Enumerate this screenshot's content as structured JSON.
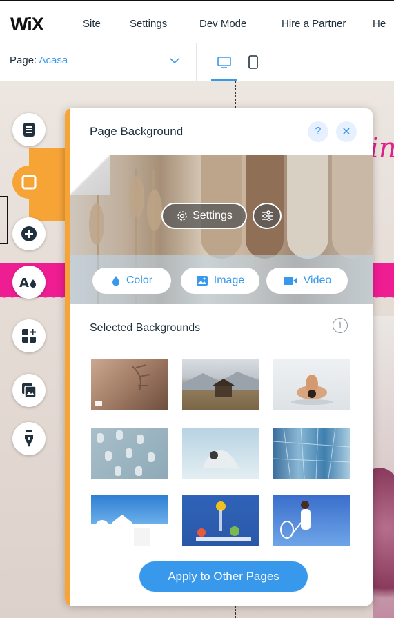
{
  "topbar": {
    "logo": "WiX",
    "menu": [
      "Site",
      "Settings",
      "Dev Mode",
      "Hire a Partner",
      "He"
    ]
  },
  "pagebar": {
    "page_label": "Page: ",
    "page_name": "Acasa",
    "devices": [
      "desktop-icon",
      "mobile-icon"
    ]
  },
  "canvas": {
    "script_text": "in"
  },
  "sidebar": {
    "tools": [
      "pages-icon",
      "background-icon",
      "add-icon",
      "theme-icon",
      "apps-icon",
      "media-icon",
      "blog-icon"
    ],
    "active_tool": "background-icon"
  },
  "panel": {
    "title": "Page Background",
    "help": "?",
    "close": "✕",
    "settings_label": "Settings",
    "buttons": {
      "color": "Color",
      "image": "Image",
      "video": "Video"
    },
    "section_label": "Selected Backgrounds",
    "info": "i",
    "apply_label": "Apply to Other Pages"
  },
  "thumbnails": [
    {
      "name": "shadow-leaves",
      "video": true
    },
    {
      "name": "mountain-hut",
      "video": false
    },
    {
      "name": "yoga-pose",
      "video": false
    },
    {
      "name": "blue-shapes",
      "video": false
    },
    {
      "name": "yoga-stretch",
      "video": false
    },
    {
      "name": "glass-building",
      "video": false
    },
    {
      "name": "white-village",
      "video": false
    },
    {
      "name": "fruit-still-life",
      "video": false
    },
    {
      "name": "tennis-player",
      "video": false
    }
  ],
  "colors": {
    "accent": "#3899ec",
    "panel_accent": "#f7a437",
    "site_pink": "#ef1d92"
  }
}
